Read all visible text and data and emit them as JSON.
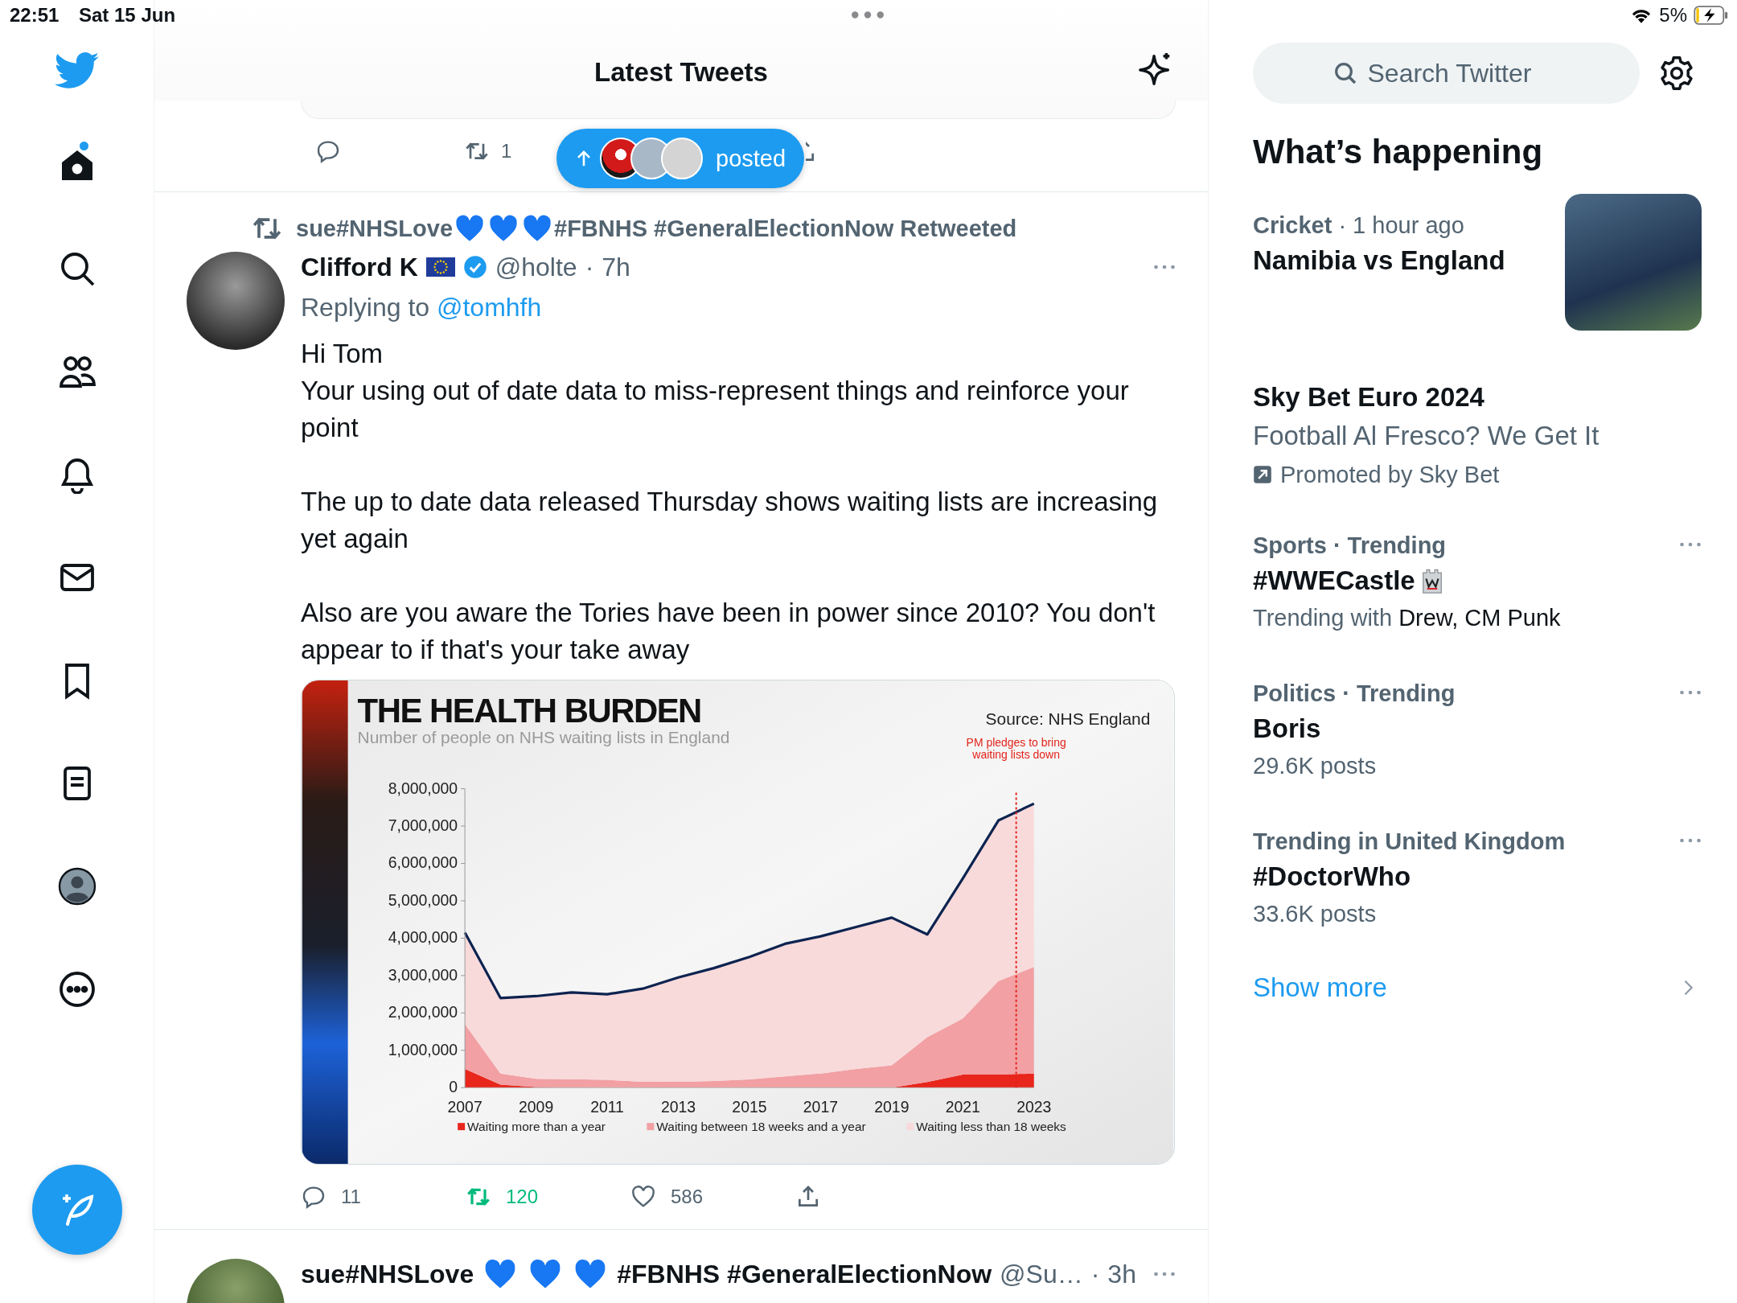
{
  "status_bar": {
    "time": "22:51",
    "date": "Sat 15 Jun",
    "battery": "5%"
  },
  "sidebar": {
    "nav": [
      {
        "kind": "home",
        "selected": true,
        "unread": true
      },
      {
        "kind": "search",
        "selected": false,
        "unread": false
      },
      {
        "kind": "communities",
        "selected": false,
        "unread": false
      },
      {
        "kind": "notifications",
        "selected": false,
        "unread": false
      },
      {
        "kind": "messages",
        "selected": false,
        "unread": false
      },
      {
        "kind": "bookmarks",
        "selected": false,
        "unread": false
      },
      {
        "kind": "lists",
        "selected": false,
        "unread": false
      },
      {
        "kind": "profile",
        "selected": false,
        "unread": false
      },
      {
        "kind": "more",
        "selected": false,
        "unread": false
      }
    ]
  },
  "header": {
    "title": "Latest Tweets"
  },
  "previous_tweet": {
    "retweets": "1"
  },
  "new_posts_pill": {
    "label": "posted"
  },
  "tweet": {
    "retweeter": {
      "before": "sue#NHSLove",
      "after": "#FBNHS #GeneralElectionNow"
    },
    "retweet_label": "Retweeted",
    "name": "Clifford K",
    "verified": true,
    "handle": "@holte",
    "separator": "·",
    "time": "7h",
    "replying_label": "Replying to",
    "replying_to": "@tomhfh",
    "paragraphs": [
      "Hi Tom\nYour using out of date data to miss-represent things and reinforce your point",
      "The up to date data released Thursday shows waiting lists are increasing yet again",
      "Also are you aware the Tories have been in power since 2010? You don't appear to if that's your take away"
    ],
    "image": {
      "subtitle": "Number of people on NHS waiting lists in England",
      "source": "Source: NHS England",
      "chart_data": {
        "type": "area",
        "title": "THE HEALTH BURDEN",
        "stacked": true,
        "x": [
          2007,
          2008,
          2009,
          2010,
          2011,
          2012,
          2013,
          2014,
          2015,
          2016,
          2017,
          2018,
          2019,
          2020,
          2021,
          2022,
          2023
        ],
        "series": [
          {
            "name": "Waiting more than a year",
            "color": "#e8261c",
            "values": [
              500000,
              80000,
              20000,
              10000,
              10000,
              10000,
              0,
              0,
              0,
              0,
              0,
              0,
              0,
              150000,
              350000,
              350000,
              380000
            ]
          },
          {
            "name": "Waiting between 18 weeks and a year",
            "color": "#f2a0a3",
            "values": [
              1200000,
              300000,
              220000,
              220000,
              200000,
              150000,
              160000,
              180000,
              220000,
              300000,
              380000,
              500000,
              600000,
              1200000,
              1500000,
              2500000,
              2850000
            ]
          },
          {
            "name": "Waiting less than 18 weeks",
            "color": "#f8dadb",
            "values": [
              2450000,
              2020000,
              2210000,
              2320000,
              2290000,
              2490000,
              2790000,
              3020000,
              3280000,
              3550000,
              3670000,
              3800000,
              3950000,
              2750000,
              3750000,
              4300000,
              4370000
            ]
          }
        ],
        "xlim": [
          2007,
          2023
        ],
        "ylim": [
          0,
          8000000
        ],
        "legend": "bottom",
        "xticks": [
          2007,
          2009,
          2011,
          2013,
          2015,
          2017,
          2019,
          2021,
          2023
        ],
        "yticks": [
          {
            "value": 0,
            "label": "0"
          },
          {
            "value": 1000000,
            "label": "1,000,000"
          },
          {
            "value": 2000000,
            "label": "2,000,000"
          },
          {
            "value": 3000000,
            "label": "3,000,000"
          },
          {
            "value": 4000000,
            "label": "4,000,000"
          },
          {
            "value": 5000000,
            "label": "5,000,000"
          },
          {
            "value": 6000000,
            "label": "6,000,000"
          },
          {
            "value": 7000000,
            "label": "7,000,000"
          },
          {
            "value": 8000000,
            "label": "8,000,000"
          }
        ],
        "ref_lines": [
          {
            "axis": "x",
            "value": 2022.5,
            "color": "#e2231a",
            "label": "PM pledges to bring waiting lists down"
          }
        ]
      }
    },
    "replies": "11",
    "retweets": "120",
    "retweeted": true,
    "likes": "586",
    "liked": false
  },
  "next_tweet": {
    "name": {
      "before": "sue#NHSLove",
      "after": "#FBNHS #GeneralElectionNow"
    },
    "handle": "@Su…",
    "separator": "·",
    "time": "3h"
  },
  "search": {
    "placeholder": "Search Twitter"
  },
  "trends_title": "What’s happening",
  "trends": [
    {
      "kind": "news",
      "category": "Cricket",
      "time": "· 1 hour ago",
      "title": "Namibia vs England"
    },
    {
      "kind": "promoted",
      "title": "Sky Bet Euro 2024",
      "subtitle": "Football Al Fresco? We Get It",
      "promoted_by": "Promoted by Sky Bet"
    },
    {
      "kind": "trend",
      "context": "Sports · Trending",
      "title": "#WWECastle",
      "detail_label": "Trending with",
      "detail": "Drew, CM Punk"
    },
    {
      "kind": "trend",
      "context": "Politics · Trending",
      "title": "Boris",
      "detail": "29.6K posts"
    },
    {
      "kind": "trend",
      "context": "Trending in United Kingdom",
      "title": "#DoctorWho",
      "detail": "33.6K posts"
    }
  ],
  "show_more": "Show more"
}
